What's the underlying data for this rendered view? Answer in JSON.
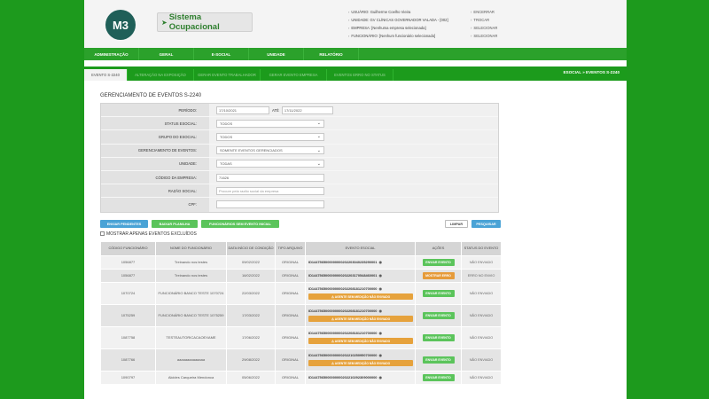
{
  "header": {
    "logo_text": "M3",
    "system_title": "Sistema Ocupacional",
    "user_info": [
      {
        "label": "USUÁRIO:",
        "value": "Guilherme Coelho Vieira"
      },
      {
        "label": "UNIDADE:",
        "value": "GV CLÍNICAS GOVERNADOR VALADA - [002]"
      },
      {
        "label": "EMPRESA:",
        "value": "[Nenhuma empresa selecionada]"
      },
      {
        "label": "FUNCIONÁRIO:",
        "value": "[Nenhum funcionário selecionado]"
      }
    ],
    "actions": [
      "ENCERRAR",
      "TROCAR",
      "SELECIONAR",
      "SELECIONAR"
    ]
  },
  "topnav": [
    "ADMINISTRAÇÃO",
    "GERAL",
    "E-SOCIAL",
    "UNIDADE",
    "RELATÓRIO"
  ],
  "tabs": [
    {
      "label": "EVENTO S-2240",
      "active": true
    },
    {
      "label": "ALTERAÇÃO NA EXPOSIÇÃO",
      "active": false
    },
    {
      "label": "GERAR EVENTO TRABALHADOR",
      "active": false
    },
    {
      "label": "GERAR EVENTO EMPRESA",
      "active": false
    },
    {
      "label": "EVENTOS ERRO NO STATUS",
      "active": false
    }
  ],
  "tabs_title": "ESOCIAL » EVENTOS S-2240",
  "section_title": "GERENCIAMENTO DE EVENTOS S-2240",
  "filters": {
    "periodo_label": "PERÍODO:",
    "periodo_from": "17/10/2021",
    "periodo_ate_label": "ATÉ",
    "periodo_to": "17/11/2022",
    "status_label": "STATUS ESOCIAL:",
    "status_value": "TODOS",
    "grupo_label": "GRUPO DO ESOCIAL:",
    "grupo_value": "TODOS",
    "gerenciamento_label": "GERENCIAMENTO DE EVENTOS:",
    "gerenciamento_value": "SOMENTE EVENTOS GERENCIADOS",
    "unidade_label": "UNIDADE:",
    "unidade_value": "TODAS",
    "codigo_label": "CÓDIGO DA EMPRESA:",
    "codigo_value": "71626",
    "razao_label": "RAZÃO SOCIAL:",
    "razao_placeholder": "Procure pela razão social da empresa",
    "cpf_label": "CPF:",
    "cpf_value": ""
  },
  "buttons": {
    "enviar_pendentes": "ENVIAR PENDENTES",
    "baixar_planilha": "BAIXAR PLANILHA",
    "funcionarios_sem_evento": "FUNCIONÁRIOS SEM EVENTO INICIAL",
    "limpar": "LIMPAR",
    "pesquisar": "PESQUISAR"
  },
  "checkbox_label": "MOSTRAR APENAS EVENTOS EXCLUÍDOS",
  "table": {
    "headers": [
      "CÓDIGO FUNCIONÁRIO",
      "NOME DO FUNCIONÁRIO",
      "DATA INÍCIO DE CONDIÇÃO",
      "TIPO ARQUIVO",
      "EVENTO ESOCIAL",
      "AÇÕES",
      "STATUS DO EVENTO"
    ],
    "rows": [
      {
        "codigo": "1056877",
        "nome": "Treinando nos testes",
        "data": "09/02/2022",
        "tipo": "ORIGINAL",
        "evento": "ID1447565000000000202203040235290001",
        "warning": "",
        "acao": "ENVIAR EVENTO",
        "acao_tipo": "green",
        "status": "NÃO ENVIADO"
      },
      {
        "codigo": "1056877",
        "nome": "Treinando nos testes",
        "data": "16/02/2022",
        "tipo": "ORIGINAL",
        "evento": "ID1447565000000000202203170548460001",
        "warning": "",
        "acao": "MOSTRAR ERRO",
        "acao_tipo": "orange",
        "status": "ERRO NO ENVIO"
      },
      {
        "codigo": "1070724",
        "nome": "FUNCIONÁRIO BANCO TESTE 1070724",
        "data": "22/03/2022",
        "tipo": "ORIGINAL",
        "evento": "ID1447565000000000202208181210700000",
        "warning": "AGENTE SEM MEDIÇÃO NÃO ENVIADO",
        "acao": "ENVIAR EVENTO",
        "acao_tipo": "green",
        "status": "NÃO ENVIADO"
      },
      {
        "codigo": "1075259",
        "nome": "FUNCIONÁRIO BANCO TESTE 1075259",
        "data": "17/03/2022",
        "tipo": "ORIGINAL",
        "evento": "ID1447565000000000202208181210700000",
        "warning": "AGENTE SEM MEDIÇÃO NÃO ENVIADO",
        "acao": "ENVIAR EVENTO",
        "acao_tipo": "green",
        "status": "NÃO ENVIADO"
      },
      {
        "codigo": "1087758",
        "nome": "TESTEAUTORICACAOEXAME",
        "data": "17/06/2022",
        "tipo": "ORIGINAL",
        "evento": "ID1447565000000000202208181210700000",
        "warning": "AGENTE SEM MEDIÇÃO NÃO ENVIADO",
        "acao": "ENVIAR EVENTO",
        "acao_tipo": "green",
        "status": "NÃO ENVIADO"
      },
      {
        "codigo": "1087766",
        "nome": "aaaaaaaaaaaaaa",
        "data": "29/08/2022",
        "tipo": "ORIGINAL",
        "evento": "ID1447565000000000202210250950700000",
        "warning": "AGENTE SEM MEDIÇÃO NÃO ENVIADO",
        "acao": "ENVIAR EVENTO",
        "acao_tipo": "green",
        "status": "NÃO ENVIADO"
      },
      {
        "codigo": "1090797",
        "nome": "Alcides Carqueira Mendonca",
        "data": "05/06/2022",
        "tipo": "ORIGINAL",
        "evento": "ID1447565000000000202210292309000000",
        "warning": "",
        "acao": "ENVIAR EVENTO",
        "acao_tipo": "green",
        "status": "NÃO ENVIADO"
      }
    ]
  },
  "colors": {
    "brand_green": "#1d9a1d",
    "button_blue": "#4aa3d6",
    "button_green": "#5bc45b",
    "warning_orange": "#e6a23c"
  }
}
